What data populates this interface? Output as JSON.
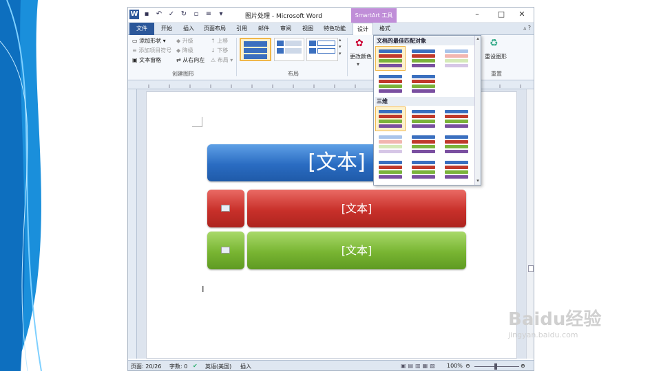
{
  "window": {
    "title": "图片处理 - Microsoft Word",
    "context_tab": "SmartArt 工具"
  },
  "tabs": [
    "文件",
    "开始",
    "插入",
    "页面布局",
    "引用",
    "邮件",
    "审阅",
    "视图",
    "特色功能",
    "设计",
    "格式"
  ],
  "ribbon": {
    "create": {
      "add_shape": "添加形状",
      "add_bullet": "添加项目符号",
      "text_pane": "文本窗格",
      "promote": "升级",
      "demote": "降级",
      "rtl": "从右向左",
      "move_up": "上移",
      "move_down": "下移",
      "layout": "布局",
      "group": "创建图形"
    },
    "layout_group": "布局",
    "change_colors": "更改颜色",
    "reset": {
      "reset_graphic": "重设图形",
      "group": "重置"
    }
  },
  "gallery": {
    "section1": "文档的最佳匹配对象",
    "section2": "三维"
  },
  "diagram": {
    "top_text": "[文本]",
    "mid_text": "[文本]",
    "bot_text": "[文本]"
  },
  "status": {
    "page": "页面: 20/26",
    "words": "字数: 0",
    "lang": "英语(美国)",
    "mode": "插入",
    "zoom": "100%"
  },
  "watermark": {
    "text": "Baidu经验",
    "url": "jingyan.baidu.com"
  }
}
